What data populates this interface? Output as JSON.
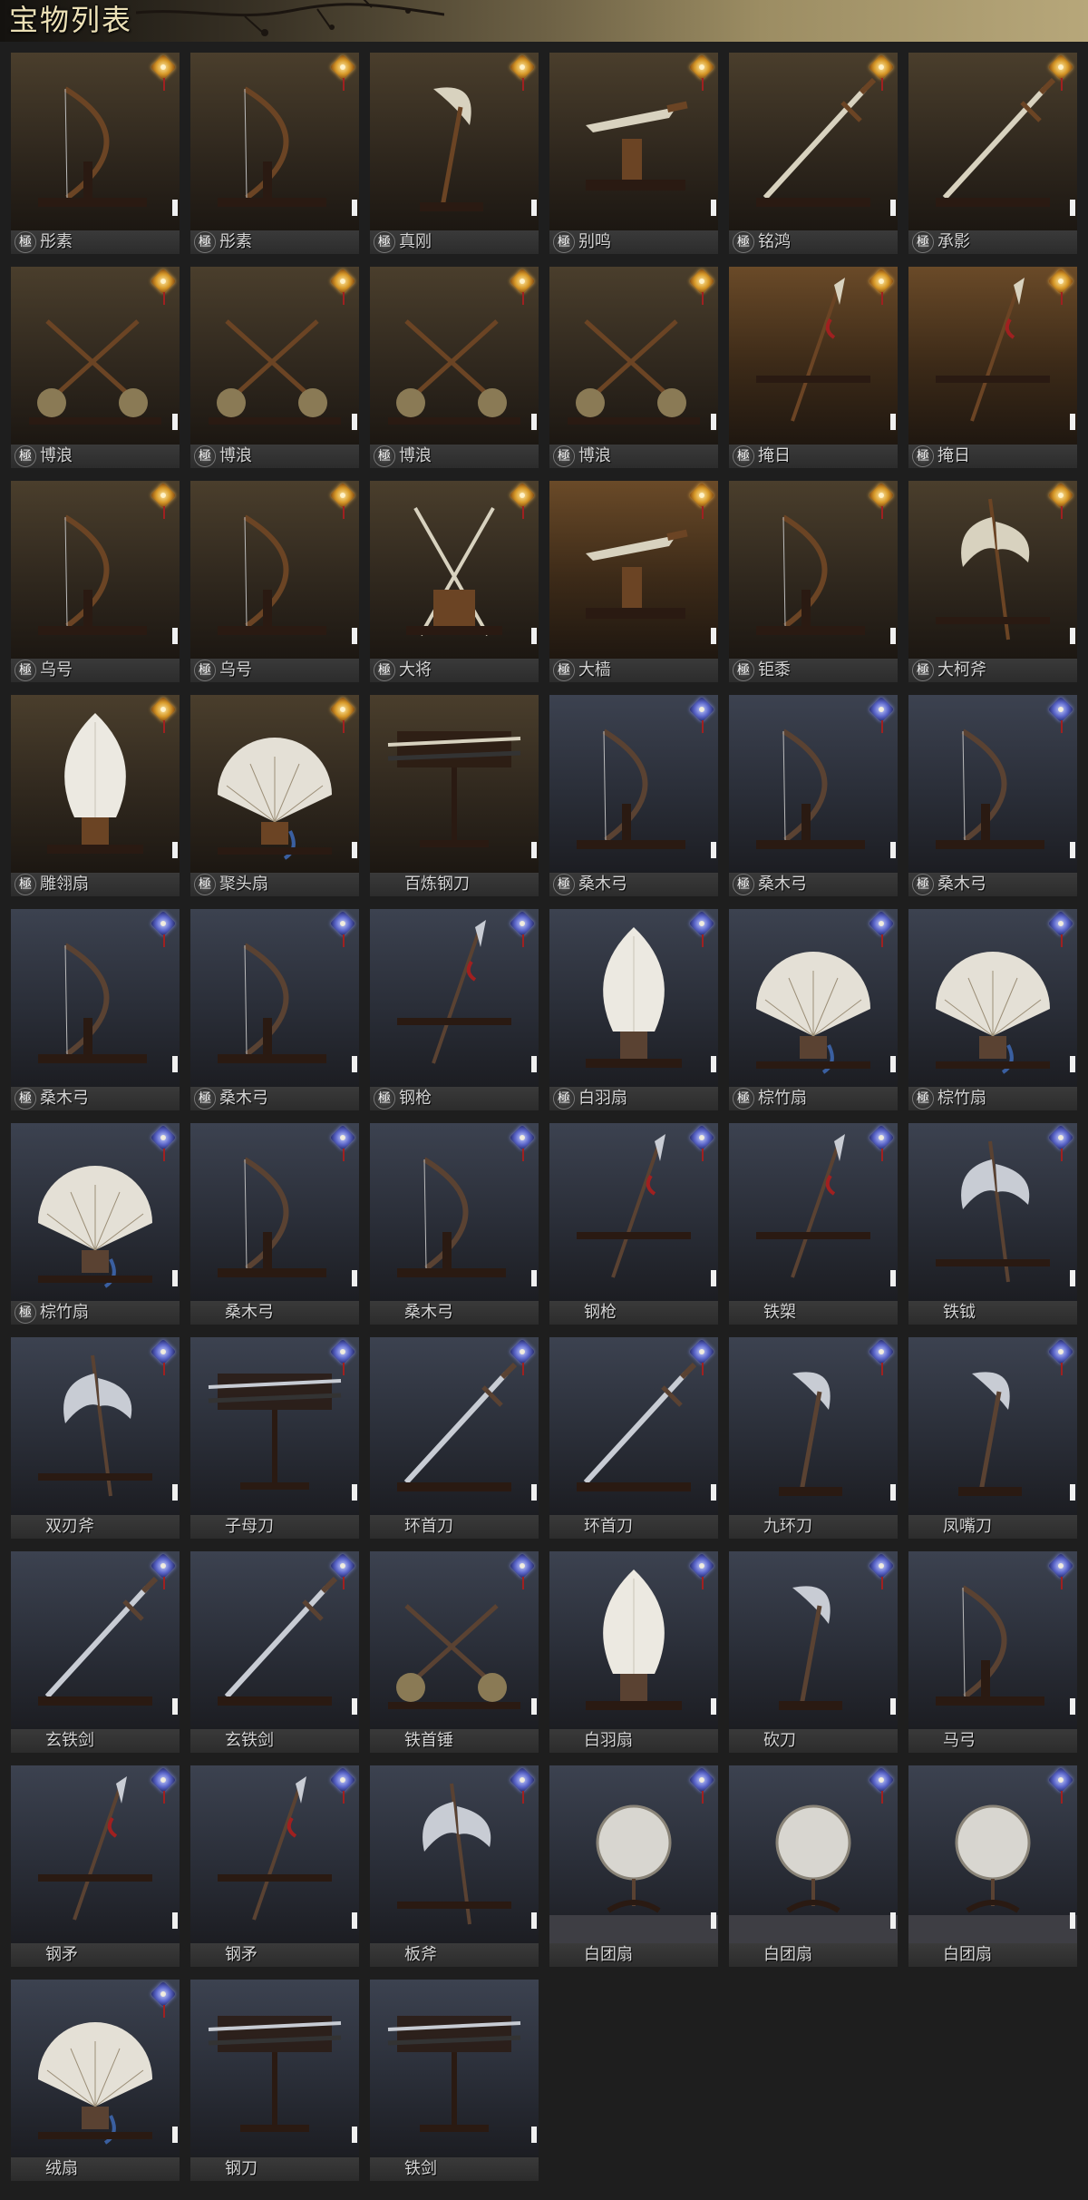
{
  "page": {
    "title": "宝物列表"
  },
  "grade_mark": "極",
  "colors": {
    "gold_badge": "#d79a2a",
    "blue_badge": "#5b66c9",
    "label_text": "#d4d4d4",
    "title_text": "#ece0b6"
  },
  "items": [
    {
      "name": "彤素",
      "grade": true,
      "badge": "gold",
      "scene": "gold",
      "weapon": "bow"
    },
    {
      "name": "彤素",
      "grade": true,
      "badge": "gold",
      "scene": "gold",
      "weapon": "bow"
    },
    {
      "name": "真刚",
      "grade": true,
      "badge": "gold",
      "scene": "gold",
      "weapon": "crescent"
    },
    {
      "name": "别鸣",
      "grade": true,
      "badge": "gold",
      "scene": "gold",
      "weapon": "dagger"
    },
    {
      "name": "铭鸿",
      "grade": true,
      "badge": "gold",
      "scene": "gold",
      "weapon": "sword"
    },
    {
      "name": "承影",
      "grade": true,
      "badge": "gold",
      "scene": "gold",
      "weapon": "sword"
    },
    {
      "name": "博浪",
      "grade": true,
      "badge": "gold",
      "scene": "gold",
      "weapon": "hammers"
    },
    {
      "name": "博浪",
      "grade": true,
      "badge": "gold",
      "scene": "gold",
      "weapon": "hammers"
    },
    {
      "name": "博浪",
      "grade": true,
      "badge": "gold",
      "scene": "gold",
      "weapon": "hammers"
    },
    {
      "name": "博浪",
      "grade": true,
      "badge": "gold",
      "scene": "gold",
      "weapon": "hammers"
    },
    {
      "name": "掩日",
      "grade": true,
      "badge": "gold",
      "scene": "amber",
      "weapon": "spear"
    },
    {
      "name": "掩日",
      "grade": true,
      "badge": "gold",
      "scene": "amber",
      "weapon": "spear"
    },
    {
      "name": "乌号",
      "grade": true,
      "badge": "gold",
      "scene": "gold",
      "weapon": "bow"
    },
    {
      "name": "乌号",
      "grade": true,
      "badge": "gold",
      "scene": "gold",
      "weapon": "bow"
    },
    {
      "name": "大将",
      "grade": true,
      "badge": "gold",
      "scene": "gold",
      "weapon": "crossed"
    },
    {
      "name": "大樯",
      "grade": true,
      "badge": "gold",
      "scene": "amber",
      "weapon": "dagger"
    },
    {
      "name": "钜黍",
      "grade": true,
      "badge": "gold",
      "scene": "gold",
      "weapon": "bow"
    },
    {
      "name": "大柯斧",
      "grade": true,
      "badge": "gold",
      "scene": "gold",
      "weapon": "axe"
    },
    {
      "name": "雕翎扇",
      "grade": true,
      "badge": "gold",
      "scene": "gold",
      "weapon": "feather"
    },
    {
      "name": "聚头扇",
      "grade": true,
      "badge": "gold",
      "scene": "gold",
      "weapon": "fan"
    },
    {
      "name": "百炼钢刀",
      "grade": false,
      "badge": "none",
      "scene": "gold",
      "weapon": "rack"
    },
    {
      "name": "桑木弓",
      "grade": true,
      "badge": "blue",
      "scene": "blue",
      "weapon": "bow"
    },
    {
      "name": "桑木弓",
      "grade": true,
      "badge": "blue",
      "scene": "blue",
      "weapon": "bow"
    },
    {
      "name": "桑木弓",
      "grade": true,
      "badge": "blue",
      "scene": "blue",
      "weapon": "bow"
    },
    {
      "name": "桑木弓",
      "grade": true,
      "badge": "blue",
      "scene": "blue",
      "weapon": "bow"
    },
    {
      "name": "桑木弓",
      "grade": true,
      "badge": "blue",
      "scene": "blue",
      "weapon": "bow"
    },
    {
      "name": "钢枪",
      "grade": true,
      "badge": "blue",
      "scene": "blue",
      "weapon": "spear"
    },
    {
      "name": "白羽扇",
      "grade": true,
      "badge": "blue",
      "scene": "blue",
      "weapon": "feather"
    },
    {
      "name": "棕竹扇",
      "grade": true,
      "badge": "blue",
      "scene": "blue",
      "weapon": "fan"
    },
    {
      "name": "棕竹扇",
      "grade": true,
      "badge": "blue",
      "scene": "blue",
      "weapon": "fan"
    },
    {
      "name": "棕竹扇",
      "grade": true,
      "badge": "blue",
      "scene": "blue",
      "weapon": "fan"
    },
    {
      "name": "桑木弓",
      "grade": false,
      "badge": "blue",
      "scene": "blue",
      "weapon": "bow"
    },
    {
      "name": "桑木弓",
      "grade": false,
      "badge": "blue",
      "scene": "blue",
      "weapon": "bow"
    },
    {
      "name": "钢枪",
      "grade": false,
      "badge": "blue",
      "scene": "blue",
      "weapon": "spear"
    },
    {
      "name": "铁槊",
      "grade": false,
      "badge": "blue",
      "scene": "blue",
      "weapon": "spear"
    },
    {
      "name": "铁钺",
      "grade": false,
      "badge": "blue",
      "scene": "blue",
      "weapon": "axe"
    },
    {
      "name": "双刃斧",
      "grade": false,
      "badge": "blue",
      "scene": "blue",
      "weapon": "axe"
    },
    {
      "name": "子母刀",
      "grade": false,
      "badge": "blue",
      "scene": "blue",
      "weapon": "rack"
    },
    {
      "name": "环首刀",
      "grade": false,
      "badge": "blue",
      "scene": "blue",
      "weapon": "sword"
    },
    {
      "name": "环首刀",
      "grade": false,
      "badge": "blue",
      "scene": "blue",
      "weapon": "sword"
    },
    {
      "name": "九环刀",
      "grade": false,
      "badge": "blue",
      "scene": "blue",
      "weapon": "crescent"
    },
    {
      "name": "凤嘴刀",
      "grade": false,
      "badge": "blue",
      "scene": "blue",
      "weapon": "crescent"
    },
    {
      "name": "玄铁剑",
      "grade": false,
      "badge": "blue",
      "scene": "blue",
      "weapon": "sword"
    },
    {
      "name": "玄铁剑",
      "grade": false,
      "badge": "blue",
      "scene": "blue",
      "weapon": "sword"
    },
    {
      "name": "铁首锤",
      "grade": false,
      "badge": "blue",
      "scene": "blue",
      "weapon": "hammers"
    },
    {
      "name": "白羽扇",
      "grade": false,
      "badge": "blue",
      "scene": "blue",
      "weapon": "feather"
    },
    {
      "name": "砍刀",
      "grade": false,
      "badge": "blue",
      "scene": "blue",
      "weapon": "crescent"
    },
    {
      "name": "马弓",
      "grade": false,
      "badge": "blue",
      "scene": "blue",
      "weapon": "bow"
    },
    {
      "name": "钢矛",
      "grade": false,
      "badge": "blue",
      "scene": "blue",
      "weapon": "spear"
    },
    {
      "name": "钢矛",
      "grade": false,
      "badge": "blue",
      "scene": "blue",
      "weapon": "spear"
    },
    {
      "name": "板斧",
      "grade": false,
      "badge": "blue",
      "scene": "blue",
      "weapon": "axe"
    },
    {
      "name": "白团扇",
      "grade": false,
      "badge": "blue",
      "scene": "blue",
      "weapon": "round"
    },
    {
      "name": "白团扇",
      "grade": false,
      "badge": "blue",
      "scene": "blue",
      "weapon": "round"
    },
    {
      "name": "白团扇",
      "grade": false,
      "badge": "blue",
      "scene": "blue",
      "weapon": "round"
    },
    {
      "name": "绒扇",
      "grade": false,
      "badge": "blue",
      "scene": "blue",
      "weapon": "fan"
    },
    {
      "name": "钢刀",
      "grade": false,
      "badge": "none",
      "scene": "blue",
      "weapon": "rack"
    },
    {
      "name": "铁剑",
      "grade": false,
      "badge": "none",
      "scene": "blue",
      "weapon": "rack"
    }
  ]
}
